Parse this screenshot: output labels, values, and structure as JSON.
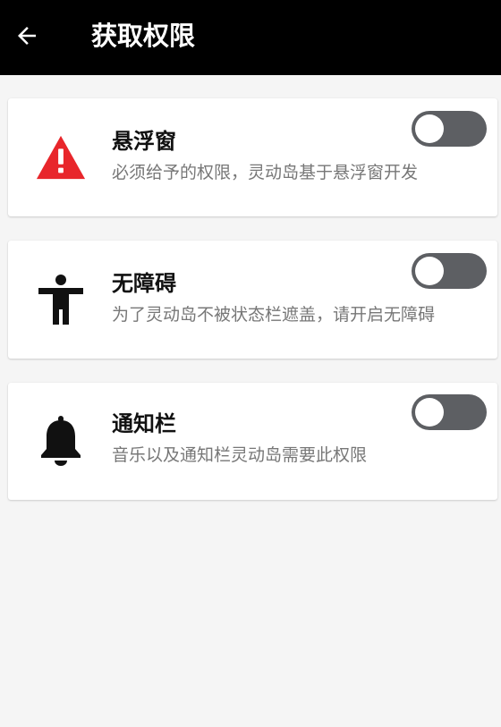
{
  "appbar": {
    "title": "获取权限",
    "back_icon": "arrow-left-icon"
  },
  "colors": {
    "appbar_bg": "#000000",
    "warning": "#e8262b",
    "toggle_off": "#5d5f63"
  },
  "permissions": [
    {
      "title": "悬浮窗",
      "description": "必须给予的权限，灵动岛基于悬浮窗开发",
      "icon": "warning-triangle-icon",
      "enabled": false
    },
    {
      "title": "无障碍",
      "description": "为了灵动岛不被状态栏遮盖，请开启无障碍",
      "icon": "accessibility-icon",
      "enabled": false
    },
    {
      "title": "通知栏",
      "description": "音乐以及通知栏灵动岛需要此权限",
      "icon": "bell-icon",
      "enabled": false
    }
  ]
}
